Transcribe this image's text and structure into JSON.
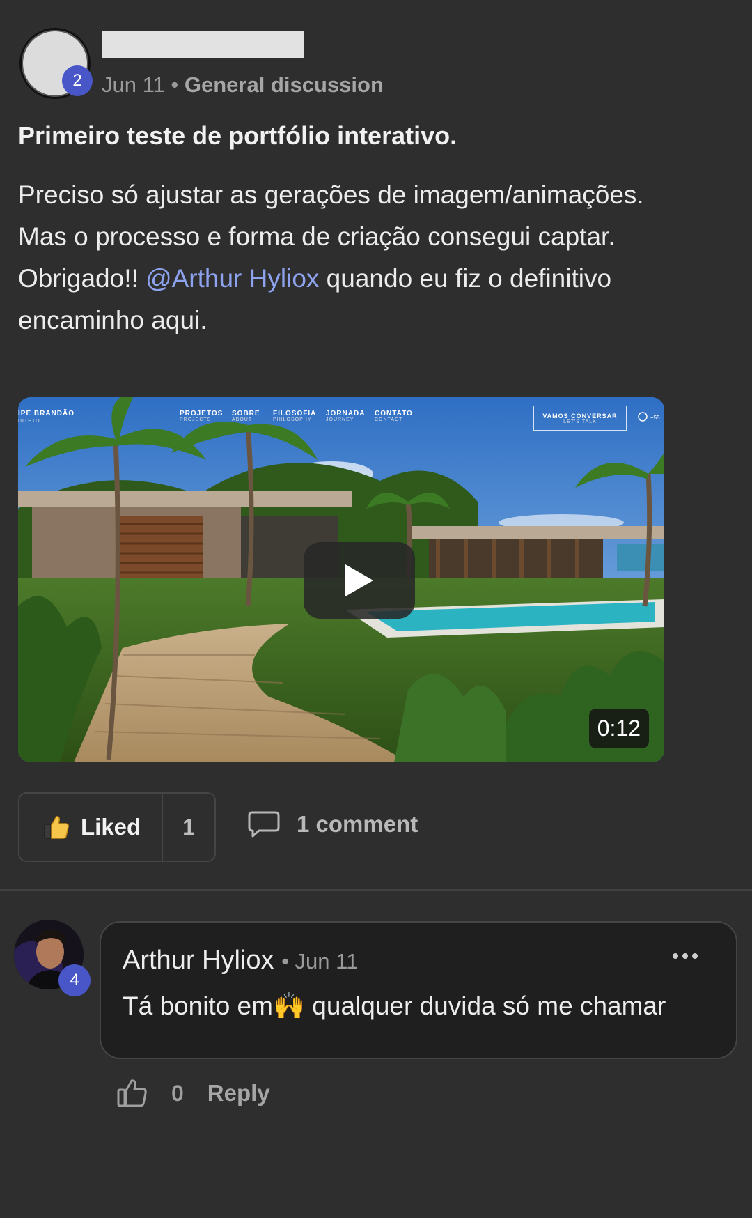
{
  "post": {
    "author_level": "2",
    "date": "Jun 11",
    "separator": "•",
    "category": "General discussion",
    "title": "Primeiro teste de portfólio interativo.",
    "body_line1": "Preciso só ajustar as gerações de imagem/animações.",
    "body_line2": "Mas o processo e forma de criação consegui captar.",
    "body_line3_pre": "Obrigado!! ",
    "mention": "@Arthur Hyliox",
    "body_line3_post": " quando eu fiz o definitivo",
    "body_line4": "encaminho aqui."
  },
  "video": {
    "duration": "0:12",
    "site_name": "IPE BRANDÃO",
    "site_sub": "UITETO",
    "nav": [
      {
        "label": "PROJETOS",
        "sub": "PROJECTS"
      },
      {
        "label": "SOBRE",
        "sub": "ABOUT"
      },
      {
        "label": "FILOSOFIA",
        "sub": "PHILOSOPHY"
      },
      {
        "label": "JORNADA",
        "sub": "JOURNEY"
      },
      {
        "label": "CONTATO",
        "sub": "CONTACT"
      }
    ],
    "cta": "VAMOS CONVERSAR",
    "cta_sub": "LET'S TALK",
    "phone": "+55"
  },
  "actions": {
    "like_label": "Liked",
    "like_count": "1",
    "comment_label": "1 comment"
  },
  "comment": {
    "author": "Arthur Hyliox",
    "author_level": "4",
    "date": "• Jun 11",
    "text_pre": "Tá bonito em",
    "emoji": "🙌",
    "text_post": " qualquer duvida só me chamar",
    "like_count": "0",
    "reply_label": "Reply"
  },
  "colors": {
    "background": "#2e2e2f",
    "mention": "#8ea3ee",
    "badge": "#4856c7",
    "comment_card": "#1f1f20"
  }
}
